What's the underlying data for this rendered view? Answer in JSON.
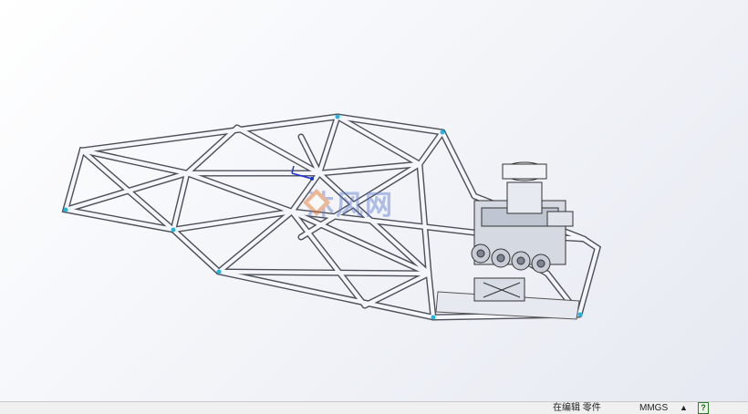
{
  "statusbar": {
    "mode": "在编辑 零件",
    "units": "MMGS",
    "units_arrow": "▲",
    "help": "?"
  },
  "watermark": {
    "text": "沐风网"
  },
  "colors": {
    "tube": "#f4f6fb",
    "tube_edge": "#4b4f57",
    "accent_cyan": "#21b7e4",
    "accent_blue": "#1a31d6"
  }
}
